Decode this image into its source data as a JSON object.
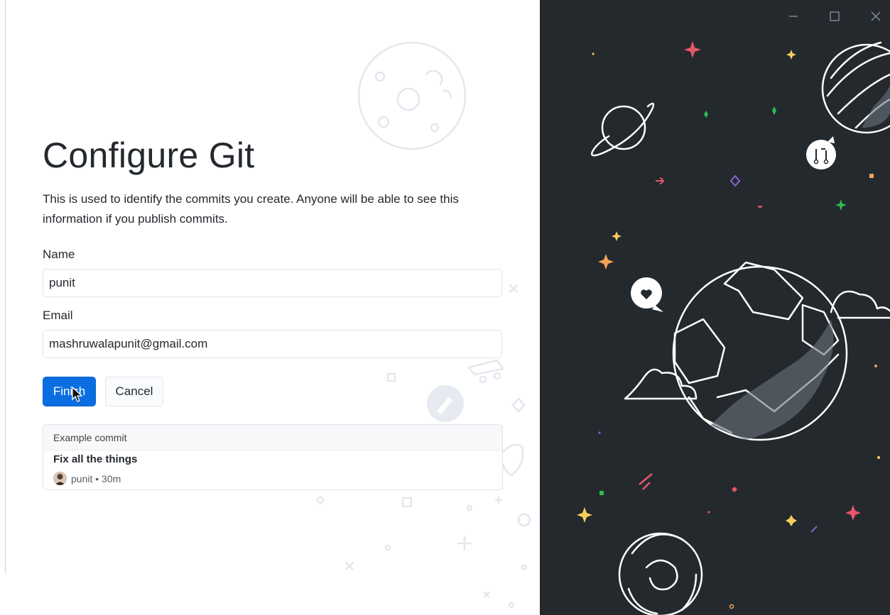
{
  "window": {
    "controls": {
      "minimize_icon": "minimize-icon",
      "maximize_icon": "maximize-icon",
      "close_icon": "close-icon"
    }
  },
  "page": {
    "title": "Configure Git",
    "description": "This is used to identify the commits you create. Anyone will be able to see this information if you publish commits."
  },
  "form": {
    "name_label": "Name",
    "name_value": "punit",
    "email_label": "Email",
    "email_value": "mashruwalapunit@gmail.com"
  },
  "buttons": {
    "finish": "Finish",
    "cancel": "Cancel"
  },
  "example_commit": {
    "header": "Example commit",
    "message": "Fix all the things",
    "meta": "punit • 30m"
  },
  "colors": {
    "primary": "#0b6ee0",
    "sidebar_bg": "#24292e"
  }
}
